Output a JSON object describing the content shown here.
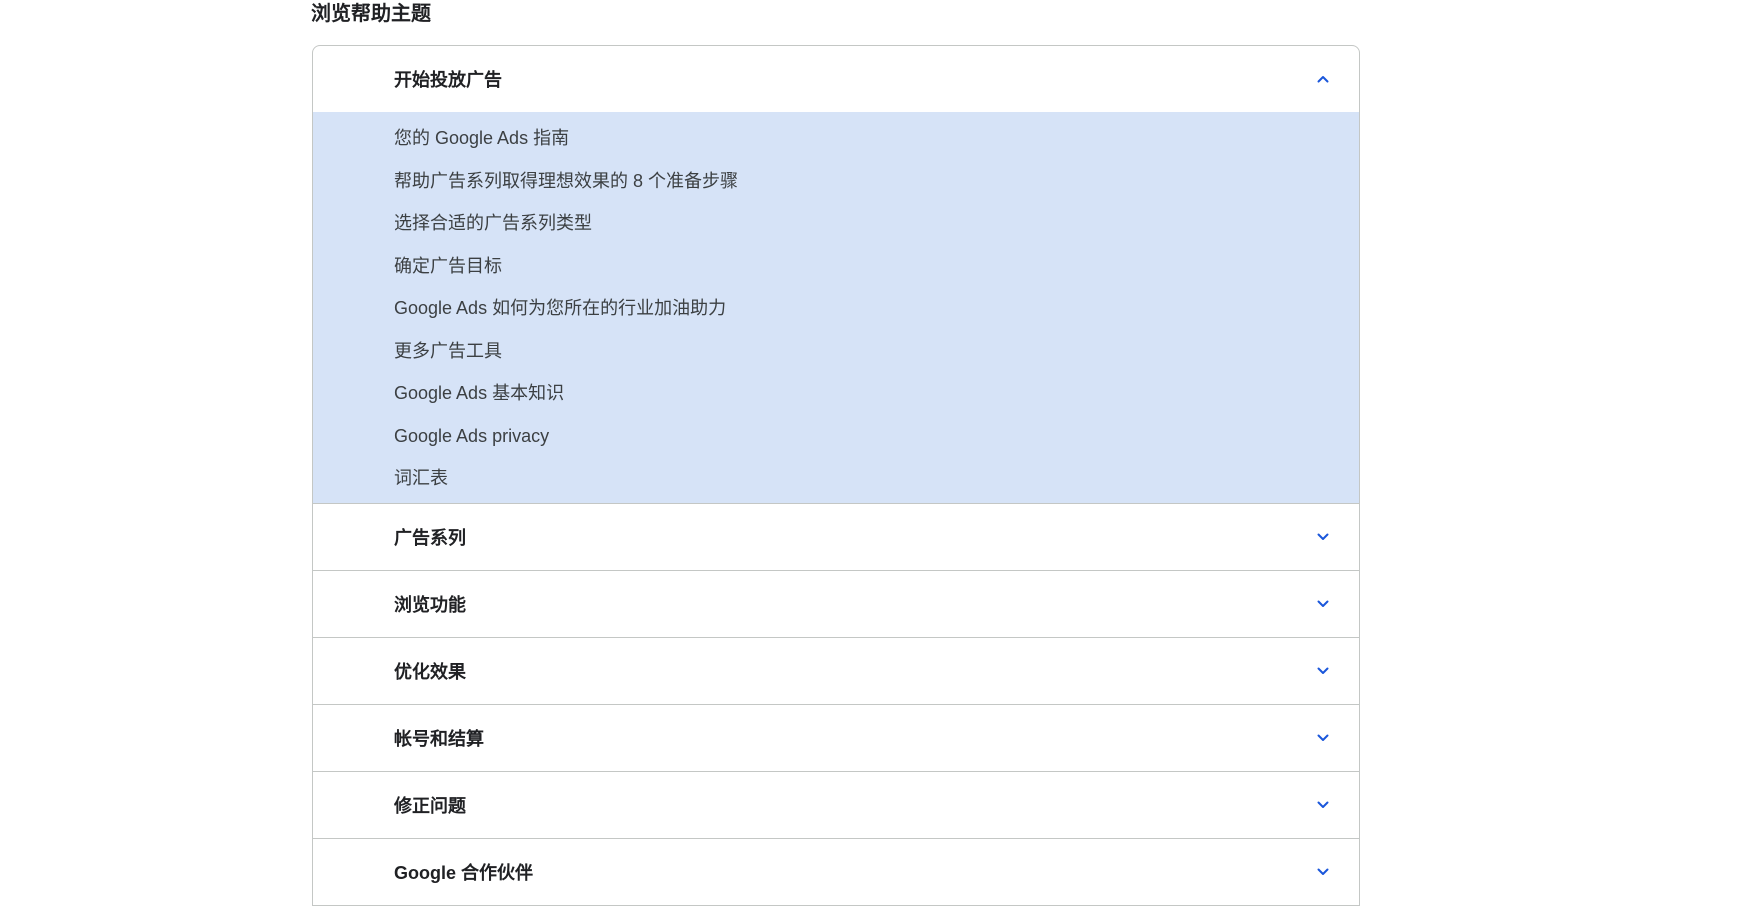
{
  "page": {
    "section_title": "浏览帮助主题"
  },
  "accordion": {
    "accent_color": "#1a56db",
    "expanded_bg": "#d6e3f7",
    "items": [
      {
        "title": "开始投放广告",
        "expanded": true,
        "chevron": "chevron-up-icon",
        "links": [
          "您的 Google Ads 指南",
          "帮助广告系列取得理想效果的 8 个准备步骤",
          "选择合适的广告系列类型",
          "确定广告目标",
          "Google Ads 如何为您所在的行业加油助力",
          "更多广告工具",
          "Google Ads 基本知识",
          "Google Ads privacy",
          "词汇表"
        ]
      },
      {
        "title": "广告系列",
        "expanded": false,
        "chevron": "chevron-down-icon"
      },
      {
        "title": "浏览功能",
        "expanded": false,
        "chevron": "chevron-down-icon"
      },
      {
        "title": "优化效果",
        "expanded": false,
        "chevron": "chevron-down-icon"
      },
      {
        "title": "帐号和结算",
        "expanded": false,
        "chevron": "chevron-down-icon"
      },
      {
        "title": "修正问题",
        "expanded": false,
        "chevron": "chevron-down-icon"
      },
      {
        "title": "Google 合作伙伴",
        "expanded": false,
        "chevron": "chevron-down-icon"
      }
    ]
  }
}
